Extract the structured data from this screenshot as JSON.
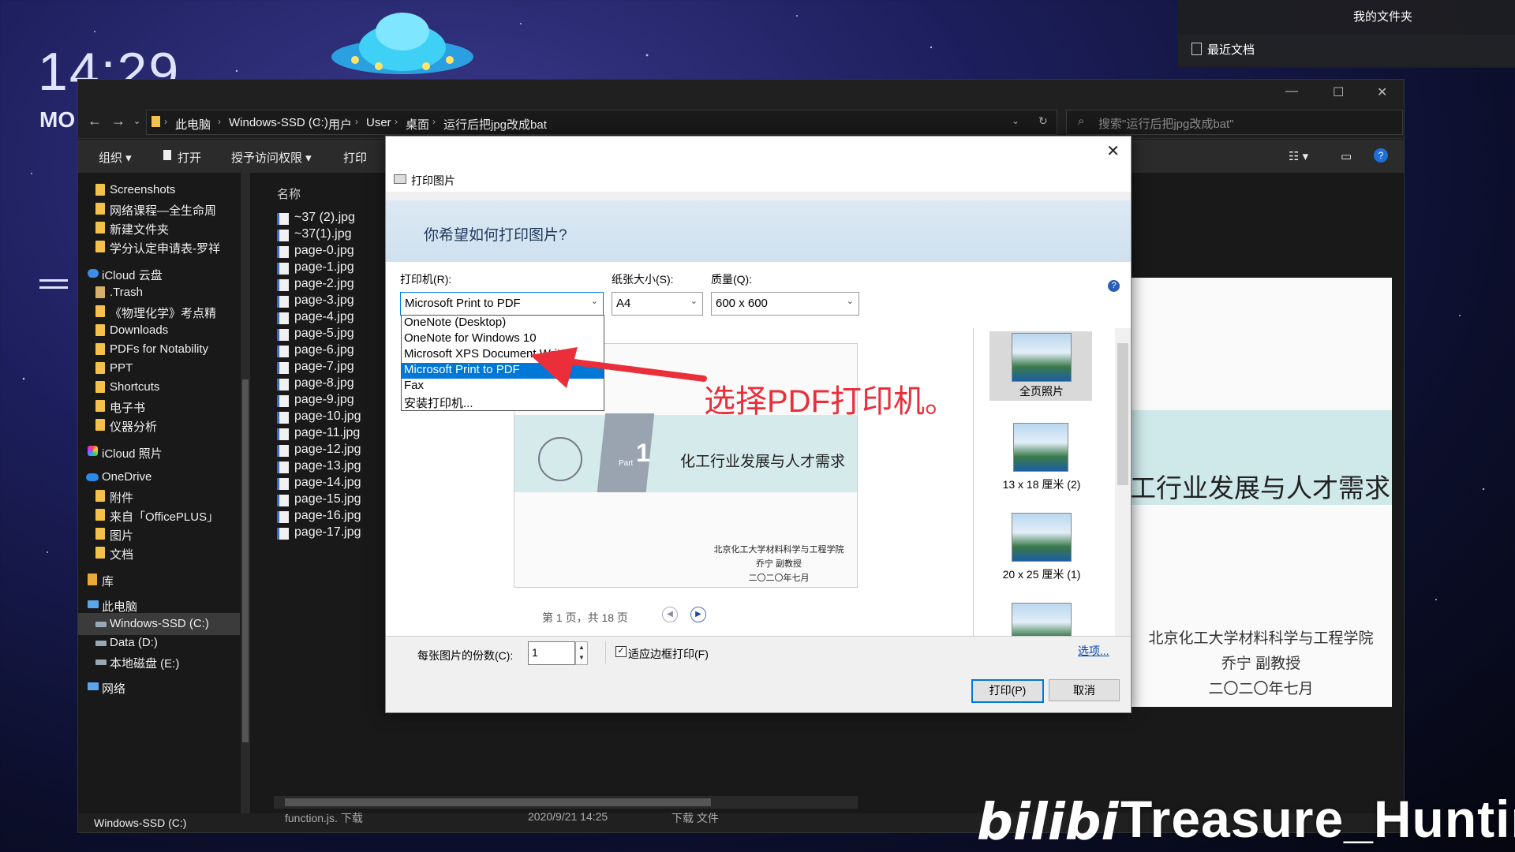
{
  "wallpaper": {
    "clock": "14:29",
    "day": "MO"
  },
  "tray": {
    "my_folder": "我的文件夹",
    "recent": "最近文档"
  },
  "explorer": {
    "controls": {
      "minimize": "—",
      "maximize": "☐",
      "close": "✕"
    },
    "breadcrumb": [
      "此电脑",
      "Windows-SSD (C:)",
      "用户",
      "User",
      "桌面",
      "运行后把jpg改成bat"
    ],
    "search_placeholder": "搜索\"运行后把jpg改成bat\"",
    "toolbar": {
      "organize": "组织",
      "open": "打开",
      "grant_access": "授予访问权限",
      "print": "打印"
    },
    "nav_items": [
      {
        "label": "Screenshots"
      },
      {
        "label": "网络课程—全生命周"
      },
      {
        "label": "新建文件夹"
      },
      {
        "label": "学分认定申请表-罗祥"
      },
      {
        "label": "iCloud 云盘"
      },
      {
        "label": ".Trash"
      },
      {
        "label": "《物理化学》考点精"
      },
      {
        "label": "Downloads"
      },
      {
        "label": "PDFs for Notability"
      },
      {
        "label": "PPT"
      },
      {
        "label": "Shortcuts"
      },
      {
        "label": "电子书"
      },
      {
        "label": "仪器分析"
      },
      {
        "label": "iCloud 照片"
      },
      {
        "label": "OneDrive"
      },
      {
        "label": "附件"
      },
      {
        "label": "来自「OfficePLUS」"
      },
      {
        "label": "图片"
      },
      {
        "label": "文档"
      },
      {
        "label": "库"
      },
      {
        "label": "此电脑"
      },
      {
        "label": "Windows-SSD (C:)"
      },
      {
        "label": "Data (D:)"
      },
      {
        "label": "本地磁盘 (E:)"
      },
      {
        "label": "网络"
      }
    ],
    "column_name": "名称",
    "files": [
      "~37 (2).jpg",
      "~37(1).jpg",
      "page-0.jpg",
      "page-1.jpg",
      "page-2.jpg",
      "page-3.jpg",
      "page-4.jpg",
      "page-5.jpg",
      "page-6.jpg",
      "page-7.jpg",
      "page-8.jpg",
      "page-9.jpg",
      "page-10.jpg",
      "page-11.jpg",
      "page-12.jpg",
      "page-13.jpg",
      "page-14.jpg",
      "page-15.jpg",
      "page-16.jpg",
      "page-17.jpg"
    ],
    "bottom_row": {
      "name": "function.js. 下载",
      "date": "2020/9/21 14:25",
      "type": "下载 文件"
    },
    "bottom_drive": "Windows-SSD (C:)",
    "preview": {
      "title": "工行业发展与人才需求",
      "line1": "北京化工大学材料科学与工程学院",
      "line2": "乔宁  副教授",
      "line3": "二〇二〇年七月"
    }
  },
  "dialog": {
    "title": "打印图片",
    "close": "✕",
    "question": "你希望如何打印图片?",
    "printer_label": "打印机(R):",
    "printer_value": "Microsoft Print to PDF",
    "paper_label": "纸张大小(S):",
    "paper_value": "A4",
    "quality_label": "质量(Q):",
    "quality_value": "600 x 600",
    "help": "?",
    "printer_options": [
      "OneNote (Desktop)",
      "OneNote for Windows 10",
      "Microsoft XPS Document Writer",
      "Microsoft Print to PDF",
      "Fax",
      "安装打印机..."
    ],
    "selected_option": "Microsoft Print to PDF",
    "slide": {
      "part_number": "1",
      "part_text": "Part",
      "title": "化工行业发展与人才需求",
      "line1": "北京化工大学材料科学与工程学院",
      "line2": "乔宁  副教授",
      "line3": "二〇二〇年七月"
    },
    "pager": "第 1 页，共 18 页",
    "layouts": [
      "全页照片",
      "13 x 18 厘米 (2)",
      "20 x 25 厘米 (1)"
    ],
    "copies_label": "每张图片的份数(C):",
    "copies_value": "1",
    "fit_label": "适应边框打印(F)",
    "options_link": "选项...",
    "print_button": "打印(P)",
    "cancel_button": "取消"
  },
  "annotation": {
    "text": "选择PDF打印机。"
  },
  "watermark": {
    "brand": "bilibili",
    "name": "Treasure_Hunting"
  },
  "colors": {
    "accent": "#0078d7",
    "annotation_red": "#ea2e3a",
    "folder_yellow": "#f4c24b",
    "dark_bg": "#191919"
  }
}
